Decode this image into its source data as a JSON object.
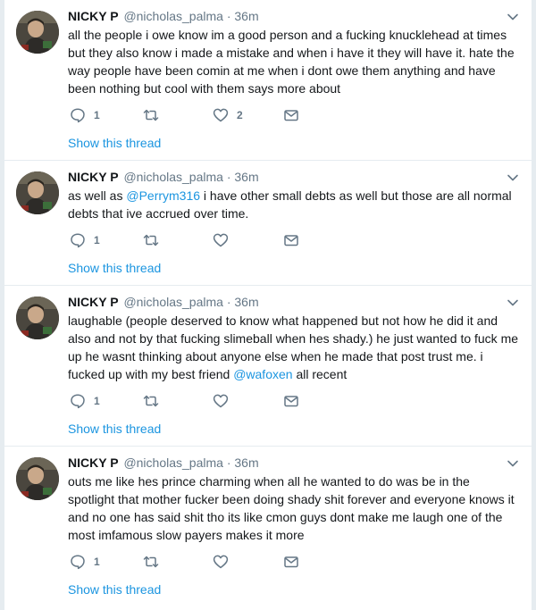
{
  "tweets": [
    {
      "name": "NICKY P",
      "handle": "@nicholas_palma",
      "separator": "·",
      "time": "36m",
      "text_before": "all the people i owe know im a good person and a fucking knucklehead at times but they also know i made a mistake and when i have it they will have it. hate the way people have been comin at me when i dont owe them anything and have been nothing but cool with them says more about",
      "mention": "",
      "text_after": "",
      "reply_count": "1",
      "retweet_count": "",
      "like_count": "2",
      "show_thread": "Show this thread"
    },
    {
      "name": "NICKY P",
      "handle": "@nicholas_palma",
      "separator": "·",
      "time": "36m",
      "text_before": "as well as ",
      "mention": "@Perrym316",
      "text_after": " i have other small debts as well but those are all normal debts that ive accrued over time.",
      "reply_count": "1",
      "retweet_count": "",
      "like_count": "",
      "show_thread": "Show this thread"
    },
    {
      "name": "NICKY P",
      "handle": "@nicholas_palma",
      "separator": "·",
      "time": "36m",
      "text_before": "laughable (people deserved to know what happened but not how he did it and also and not by that fucking slimeball when hes shady.) he just wanted to fuck me up he wasnt thinking about anyone else when he made that post trust me. i fucked up with my best friend ",
      "mention": "@wafoxen",
      "text_after": " all recent",
      "reply_count": "1",
      "retweet_count": "",
      "like_count": "",
      "show_thread": "Show this thread"
    },
    {
      "name": "NICKY P",
      "handle": "@nicholas_palma",
      "separator": "·",
      "time": "36m",
      "text_before": "outs me like hes prince charming when all he wanted to do was be in the spotlight that mother fucker been doing shady shit forever and everyone knows it and no one has said shit tho its like cmon guys dont make me laugh one of the most imfamous slow payers  makes it more",
      "mention": "",
      "text_after": "",
      "reply_count": "1",
      "retweet_count": "",
      "like_count": "",
      "show_thread": "Show this thread"
    }
  ],
  "icons": {
    "reply": "reply-icon",
    "retweet": "retweet-icon",
    "like": "heart-icon",
    "dm": "envelope-icon",
    "caret": "chevron-down-icon"
  },
  "colors": {
    "link": "#1b95e0",
    "secondary_text": "#657786",
    "primary_text": "#14171a",
    "divider": "#e6ecf0"
  }
}
